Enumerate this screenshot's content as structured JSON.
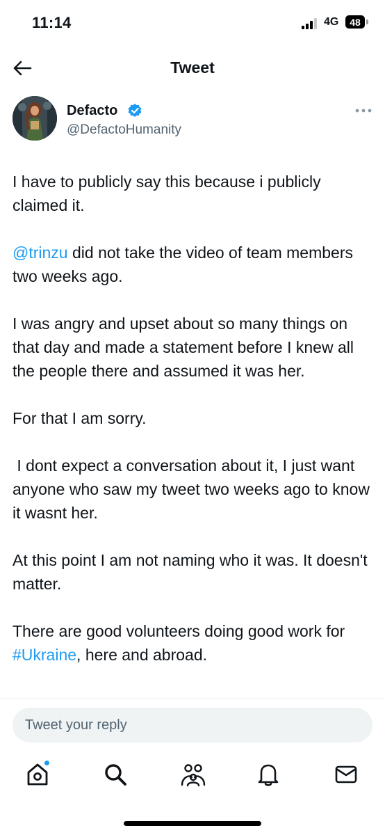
{
  "status_bar": {
    "time": "11:14",
    "network": "4G",
    "battery": "48"
  },
  "header": {
    "title": "Tweet"
  },
  "author": {
    "name": "Defacto",
    "handle": "@DefactoHumanity"
  },
  "tweet": {
    "p1": "I have to publicly say this because i publicly claimed it.",
    "p2_mention": "@trinzu",
    "p2_rest": " did not take the video of team members two weeks ago.",
    "p3": "I was angry and upset about so many things on that day and made a statement before I knew all the people there and assumed it was her.",
    "p4": "For that I am sorry.",
    "p5": " I dont expect a conversation about it, I just want anyone who saw my tweet two weeks ago to know it wasnt her.",
    "p6": "At this point I am not naming who it was. It doesn't matter.",
    "p7_start": "There are good volunteers doing good work for ",
    "p7_hashtag": "#Ukraine",
    "p7_end": ", here and abroad."
  },
  "reply": {
    "placeholder": "Tweet your reply"
  },
  "nav": [
    "home",
    "search",
    "communities",
    "notifications",
    "messages"
  ],
  "colors": {
    "accent": "#1d9bf0",
    "text": "#0f1419",
    "muted": "#536471"
  }
}
